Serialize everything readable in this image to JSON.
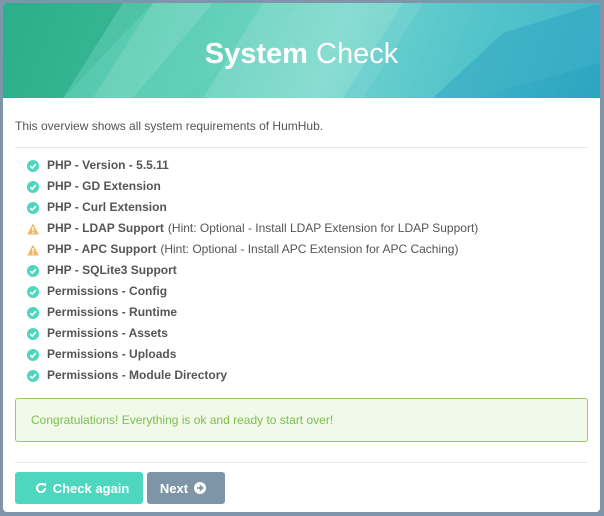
{
  "colors": {
    "success": "#4fd6be",
    "warning": "#f2b766",
    "primary_button": "#7e95a8",
    "alert_text": "#7cbf4a"
  },
  "header": {
    "title_bold": "System",
    "title_light": "Check"
  },
  "intro": "This overview shows all system requirements of HumHub.",
  "checks": [
    {
      "title": "PHP - Version - 5.5.11",
      "hint": "",
      "state": "ok",
      "icon": "check-circle-icon"
    },
    {
      "title": "PHP - GD Extension",
      "hint": "",
      "state": "ok",
      "icon": "check-circle-icon"
    },
    {
      "title": "PHP - Curl Extension",
      "hint": "",
      "state": "ok",
      "icon": "check-circle-icon"
    },
    {
      "title": "PHP - LDAP Support",
      "hint": "(Hint: Optional - Install LDAP Extension for LDAP Support)",
      "state": "warning",
      "icon": "warning-triangle-icon"
    },
    {
      "title": "PHP - APC Support",
      "hint": "(Hint: Optional - Install APC Extension for APC Caching)",
      "state": "warning",
      "icon": "warning-triangle-icon"
    },
    {
      "title": "PHP - SQLite3 Support",
      "hint": "",
      "state": "ok",
      "icon": "check-circle-icon"
    },
    {
      "title": "Permissions - Config",
      "hint": "",
      "state": "ok",
      "icon": "check-circle-icon"
    },
    {
      "title": "Permissions - Runtime",
      "hint": "",
      "state": "ok",
      "icon": "check-circle-icon"
    },
    {
      "title": "Permissions - Assets",
      "hint": "",
      "state": "ok",
      "icon": "check-circle-icon"
    },
    {
      "title": "Permissions - Uploads",
      "hint": "",
      "state": "ok",
      "icon": "check-circle-icon"
    },
    {
      "title": "Permissions - Module Directory",
      "hint": "",
      "state": "ok",
      "icon": "check-circle-icon"
    }
  ],
  "alert": "Congratulations! Everything is ok and ready to start over!",
  "buttons": {
    "check_again": "Check again",
    "check_again_icon": "refresh-icon",
    "next": "Next",
    "next_icon": "arrow-circle-right-icon"
  }
}
